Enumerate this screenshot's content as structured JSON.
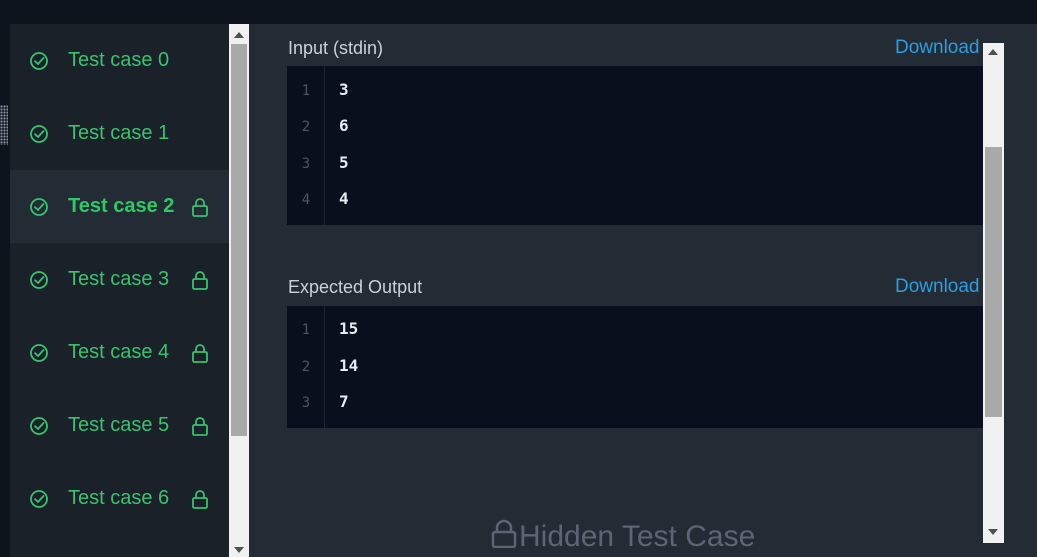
{
  "test_cases": [
    {
      "label": "Test case 0",
      "locked": false,
      "active": false
    },
    {
      "label": "Test case 1",
      "locked": false,
      "active": false
    },
    {
      "label": "Test case 2",
      "locked": true,
      "active": true
    },
    {
      "label": "Test case 3",
      "locked": true,
      "active": false
    },
    {
      "label": "Test case 4",
      "locked": true,
      "active": false
    },
    {
      "label": "Test case 5",
      "locked": true,
      "active": false
    },
    {
      "label": "Test case 6",
      "locked": true,
      "active": false
    }
  ],
  "input": {
    "title": "Input (stdin)",
    "download_label": "Download",
    "lines": [
      {
        "num": "1",
        "value": "3"
      },
      {
        "num": "2",
        "value": "6"
      },
      {
        "num": "3",
        "value": "5"
      },
      {
        "num": "4",
        "value": "4"
      }
    ]
  },
  "expected_output": {
    "title": "Expected Output",
    "download_label": "Download",
    "lines": [
      {
        "num": "1",
        "value": "15"
      },
      {
        "num": "2",
        "value": "14"
      },
      {
        "num": "3",
        "value": "7"
      }
    ]
  },
  "hidden_message": "Hidden Test Case",
  "colors": {
    "success_green": "#39c26f",
    "link_blue": "#2b9de0",
    "panel_bg": "#232b35",
    "code_bg": "#090f1c"
  },
  "icons": {
    "passed": "check-circle-icon",
    "locked": "lock-icon"
  }
}
